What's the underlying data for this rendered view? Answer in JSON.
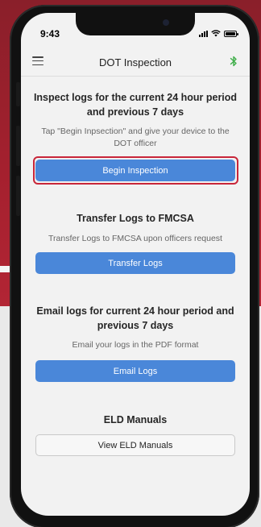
{
  "status_bar": {
    "time": "9:43"
  },
  "header": {
    "title": "DOT Inspection",
    "menu_icon": "hamburger-menu-icon",
    "bluetooth_icon": "bluetooth-icon",
    "bluetooth_color": "#3fae49"
  },
  "sections": [
    {
      "heading": "Inspect logs for the current 24 hour period and previous 7 days",
      "description": "Tap \"Begin Inpsection\" and give your device to the DOT officer",
      "button_label": "Begin Inspection"
    },
    {
      "heading": "Transfer Logs to FMCSA",
      "description": "Transfer Logs to FMCSA upon officers request",
      "button_label": "Transfer Logs"
    },
    {
      "heading": "Email logs for current 24 hour period and previous 7 days",
      "description": "Email your logs in the PDF format",
      "button_label": "Email Logs"
    },
    {
      "heading": "ELD Manuals",
      "button_label": "View ELD Manuals"
    }
  ],
  "colors": {
    "primary_button": "#4a87d9",
    "highlight": "#c8263a",
    "background_accent": "#a4202e"
  }
}
